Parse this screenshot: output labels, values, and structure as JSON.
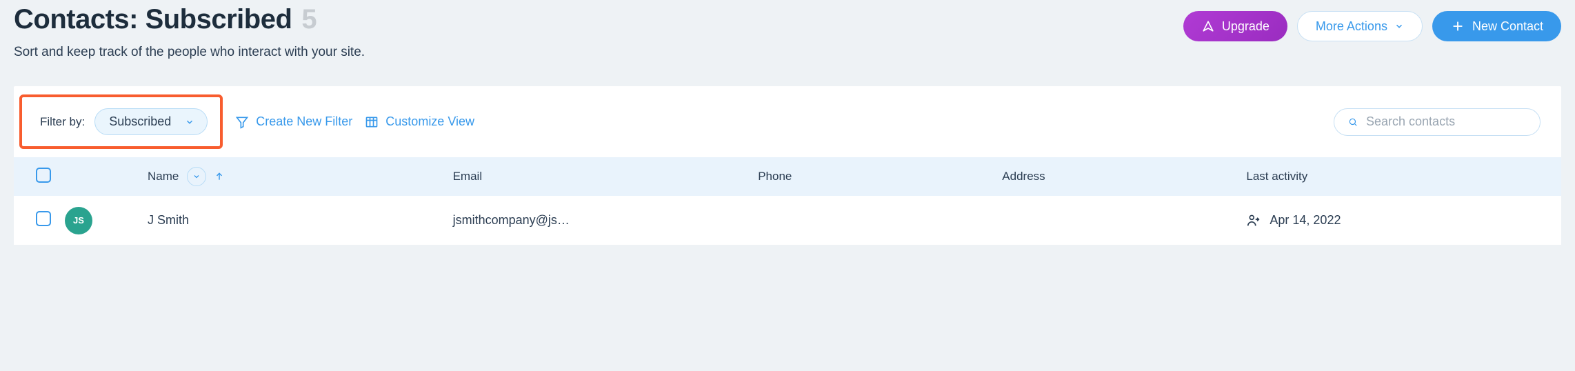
{
  "header": {
    "title": "Contacts: Subscribed",
    "count": "5",
    "subtitle": "Sort and keep track of the people who interact with your site.",
    "upgrade_label": "Upgrade",
    "more_actions_label": "More Actions",
    "new_contact_label": "New Contact"
  },
  "filter": {
    "filter_by_label": "Filter by:",
    "active_filter": "Subscribed",
    "create_new_filter_label": "Create New Filter",
    "customize_view_label": "Customize View"
  },
  "search": {
    "placeholder": "Search contacts"
  },
  "table": {
    "columns": {
      "name": "Name",
      "email": "Email",
      "phone": "Phone",
      "address": "Address",
      "last_activity": "Last activity"
    },
    "rows": [
      {
        "avatar_initials": "JS",
        "name": "J Smith",
        "email": "jsmithcompany@js…",
        "phone": "",
        "address": "",
        "last_activity": "Apr 14, 2022"
      }
    ]
  }
}
